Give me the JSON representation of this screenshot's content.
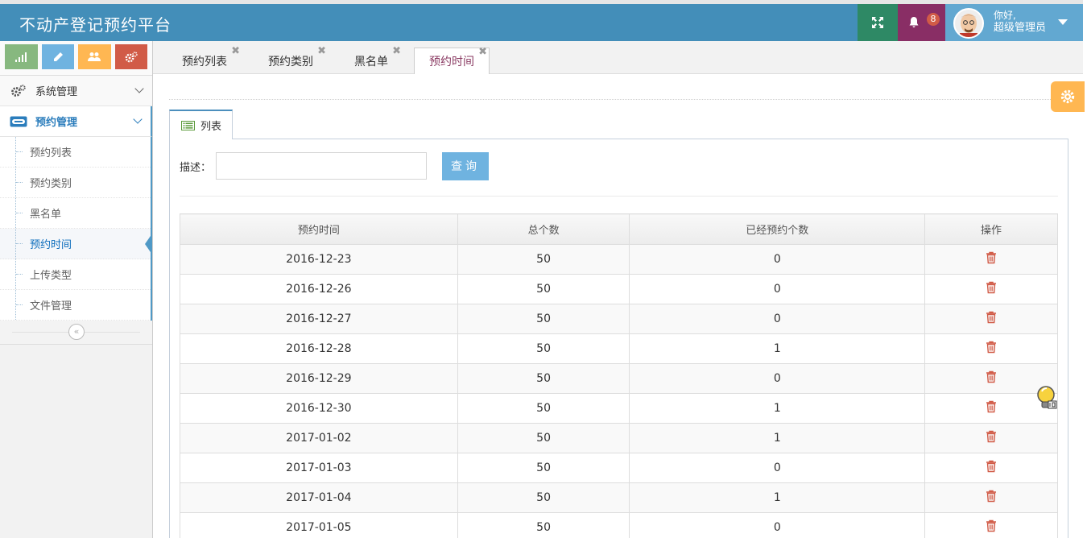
{
  "app": {
    "title": "不动产登记预约平台"
  },
  "header": {
    "notification_count": "8",
    "greeting": "你好,",
    "username": "超级管理员"
  },
  "sidebar": {
    "shortcuts": [
      "chart-icon",
      "pencil-icon",
      "users-icon",
      "cogs-icon"
    ],
    "menus": [
      {
        "label": "系统管理",
        "icon": "gears-icon"
      },
      {
        "label": "预约管理",
        "icon": "credit-card-icon"
      }
    ],
    "submenu": [
      "预约列表",
      "预约类别",
      "黑名单",
      "预约时间",
      "上传类型",
      "文件管理"
    ],
    "active_submenu": "预约时间"
  },
  "page_tabs": [
    "预约列表",
    "预约类别",
    "黑名单",
    "预约时间"
  ],
  "panel": {
    "tab_label": "列表"
  },
  "search": {
    "label": "描述：",
    "value": "",
    "button": "查询"
  },
  "table": {
    "headers": [
      "预约时间",
      "总个数",
      "已经预约个数",
      "操作"
    ],
    "rows": [
      [
        "2016-12-23",
        "50",
        "0"
      ],
      [
        "2016-12-26",
        "50",
        "0"
      ],
      [
        "2016-12-27",
        "50",
        "0"
      ],
      [
        "2016-12-28",
        "50",
        "1"
      ],
      [
        "2016-12-29",
        "50",
        "0"
      ],
      [
        "2016-12-30",
        "50",
        "1"
      ],
      [
        "2017-01-02",
        "50",
        "1"
      ],
      [
        "2017-01-03",
        "50",
        "0"
      ],
      [
        "2017-01-04",
        "50",
        "1"
      ],
      [
        "2017-01-05",
        "50",
        "0"
      ]
    ]
  },
  "colors": {
    "header": "#438eb9",
    "accent_green": "#87b87f",
    "accent_blue": "#6fb3e0",
    "accent_orange": "#ffb752",
    "accent_red": "#d15b47"
  }
}
